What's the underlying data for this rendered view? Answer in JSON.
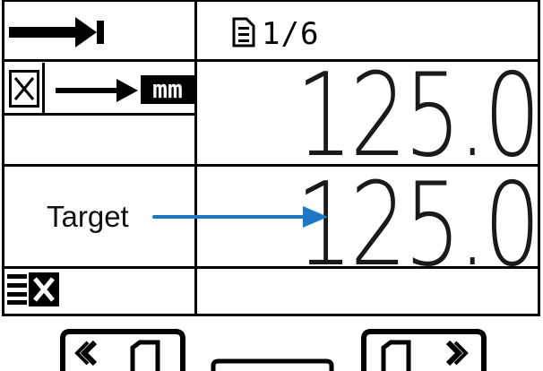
{
  "header": {
    "page_indicator": "1/6",
    "direction_icon": "arrow-right-icon",
    "page_icon": "document-icon"
  },
  "measurement": {
    "axis_icon": "axis-x-icon",
    "unit_label": "mm",
    "current_value": "125.0"
  },
  "target": {
    "label": "Target",
    "value": "125.0"
  },
  "status": {
    "icon": "list-cancel-icon"
  },
  "nav": {
    "prev_icon": "page-prev-icon",
    "next_icon": "page-next-icon"
  },
  "colors": {
    "annotation_arrow": "#1f77c4"
  }
}
